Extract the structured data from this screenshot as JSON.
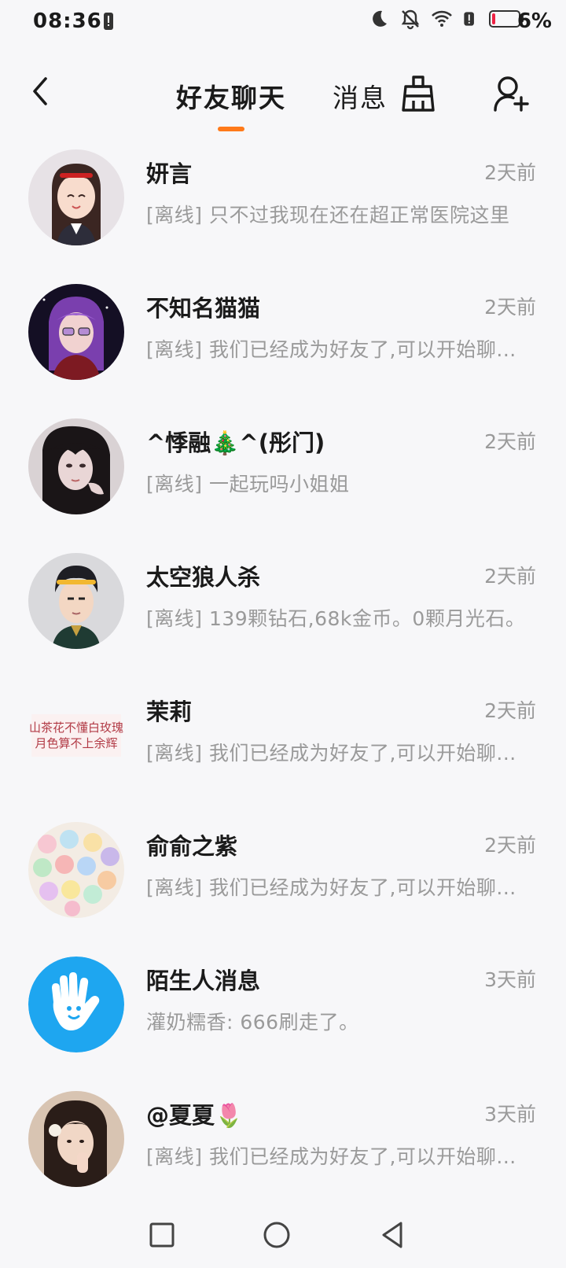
{
  "status_bar": {
    "time": "08:36",
    "battery_percent": "6%",
    "battery_level": 0.06,
    "icons": [
      "alert-icon",
      "moon-icon",
      "bell-muted-icon",
      "wifi-icon",
      "alert-icon",
      "battery-icon"
    ]
  },
  "header": {
    "tabs": [
      {
        "label": "好友聊天",
        "active": true
      },
      {
        "label": "消息",
        "active": false
      }
    ],
    "accent_color": "#ff7a1a",
    "icons": [
      "back-icon",
      "broom-clean-icon",
      "add-friend-icon"
    ]
  },
  "chats": [
    {
      "name": "妍言",
      "time": "2天前",
      "preview": "[离线] 只不过我现在还在超正常医院这里"
    },
    {
      "name": "不知名猫猫",
      "time": "2天前",
      "preview": "[离线] 我们已经成为好友了,可以开始聊..."
    },
    {
      "name": "^悸融🎄^(彤门)",
      "time": "2天前",
      "preview": "[离线] 一起玩吗小姐姐"
    },
    {
      "name": "太空狼人杀",
      "time": "2天前",
      "preview": "[离线] 139颗钻石,68k金币。0颗月光石。"
    },
    {
      "name": "茉莉",
      "time": "2天前",
      "preview": "[离线] 我们已经成为好友了,可以开始聊..."
    },
    {
      "name": "俞俞之紫",
      "time": "2天前",
      "preview": "[离线] 我们已经成为好友了,可以开始聊..."
    },
    {
      "name": "陌生人消息",
      "time": "3天前",
      "preview": "灌奶糯香: 666刷走了。"
    },
    {
      "name": "@夏夏🌷",
      "time": "3天前",
      "preview": "[离线] 我们已经成为好友了,可以开始聊..."
    }
  ],
  "nav_bar": {
    "icons": [
      "recents-square-icon",
      "home-circle-icon",
      "back-triangle-icon"
    ]
  }
}
